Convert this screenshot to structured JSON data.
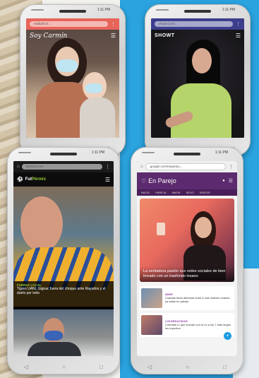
{
  "colors": {
    "background_blue": "#2aa3df",
    "phone1_bar": "#e8645a",
    "phone2_bar": "#3b3e8c",
    "phone3_accent": "#9acd32",
    "phone4_brand": "#5c2a6e"
  },
  "status_time": "1:11 PM",
  "phone1": {
    "url": "estilodf.tv/...",
    "logo": "Soy Carmín"
  },
  "phone2": {
    "url": "showt.com/...",
    "logo": "SHOWT"
  },
  "phone3": {
    "url": "futbolrd.com",
    "logo_a": "Fut",
    "logo_b": "Pérmix",
    "category": "FUERZA LOCAL",
    "headline": "Tigres UANL Gignac fuera del choque ante Rayados y el duelo por todo"
  },
  "phone4": {
    "url": "google.com/enparejo...",
    "logo": "En Parejo",
    "menu": [
      "INICIO",
      "PAREJA",
      "AMOR",
      "SEXO",
      "VIDEOS"
    ],
    "hero_caption": "La verdadera pasión sus redes sociales de bien forrado con un trasfondo insano",
    "items": [
      {
        "category": "AMOR",
        "text": "Cuántas fotos deberías subir a una relación cuando ya estás en pareja"
      },
      {
        "category": "LOS RESULTADOS",
        "text": "Cuéntate lo que sucede con tu ex a los 7 días según los expertos"
      }
    ]
  },
  "nav_icons": [
    "back-icon",
    "home-icon",
    "recent-icon"
  ]
}
